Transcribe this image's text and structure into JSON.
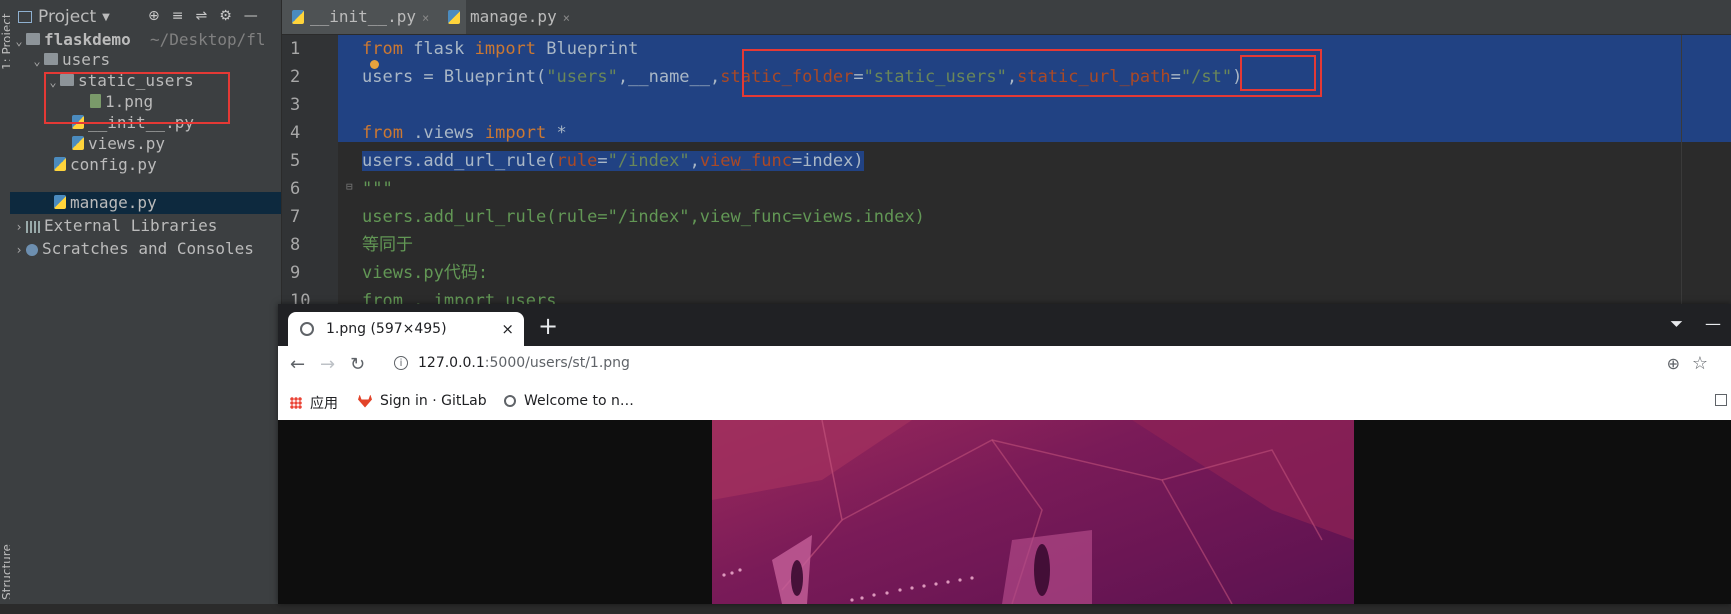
{
  "ide": {
    "left_strip": {
      "top_tab": "1: Project",
      "bottom_tab": "Structure"
    },
    "project_panel": {
      "title": "Project",
      "tree": [
        {
          "label": "flaskdemo",
          "suffix": "~/Desktop/fl",
          "depth": 0,
          "expanded": true,
          "type": "folder"
        },
        {
          "label": "users",
          "depth": 1,
          "expanded": true,
          "type": "folder"
        },
        {
          "label": "static_users",
          "depth": 2,
          "expanded": true,
          "type": "folder"
        },
        {
          "label": "1.png",
          "depth": 3,
          "type": "png"
        },
        {
          "label": "__init__.py",
          "depth": 2,
          "type": "py"
        },
        {
          "label": "views.py",
          "depth": 2,
          "type": "py"
        },
        {
          "label": "config.py",
          "depth": 1,
          "type": "py"
        },
        {
          "label": "manage.py",
          "depth": 1,
          "type": "py",
          "selected": true
        },
        {
          "label": "External Libraries",
          "depth": 0,
          "expanded": false,
          "type": "lib"
        },
        {
          "label": "Scratches and Consoles",
          "depth": 0,
          "expanded": false,
          "type": "scratch"
        }
      ]
    },
    "editor_tabs": [
      {
        "label": "__init__.py",
        "active": true
      },
      {
        "label": "manage.py",
        "active": false
      }
    ],
    "code": {
      "line_numbers": [
        "1",
        "2",
        "3",
        "4",
        "5",
        "6",
        "7",
        "8",
        "9",
        "10"
      ],
      "l1": {
        "a": "from",
        "b": " flask ",
        "c": "import",
        "d": " Blueprint"
      },
      "l2": {
        "a": "users = Blueprint(",
        "b": "\"users\"",
        "c": ",__name__,",
        "d": "static_folder",
        "e": "=",
        "f": "\"static_users\"",
        "g": ",",
        "h": "static_url_path",
        "i": "=",
        "j": "\"/st\"",
        "k": ")"
      },
      "l4": {
        "a": "from",
        "b": " .views ",
        "c": "import",
        "d": " *"
      },
      "l5": {
        "a": "users.add_url_rule(",
        "b": "rule",
        "c": "=",
        "d": "\"/index\"",
        "e": ",",
        "f": "view_func",
        "g": "=index)"
      },
      "l6": "\"\"\"",
      "l7": "users.add_url_rule(rule=\"/index\",view_func=views.index)",
      "l8": "等同于",
      "l9": "views.py代码:",
      "l10": "from . import users"
    }
  },
  "browser": {
    "tab_title": "1.png (597×495)",
    "tab_close": "×",
    "new_tab": "+",
    "url_host": "127.0.0.1",
    "url_path": ":5000/users/st/1.png",
    "bookmarks": [
      {
        "label": "应用",
        "icon": "apps-grid-icon"
      },
      {
        "label": "Sign in · GitLab",
        "icon": "gitlab-icon"
      },
      {
        "label": "Welcome to n…",
        "icon": "globe-icon"
      }
    ],
    "image_description_color": "#7a1b58"
  }
}
